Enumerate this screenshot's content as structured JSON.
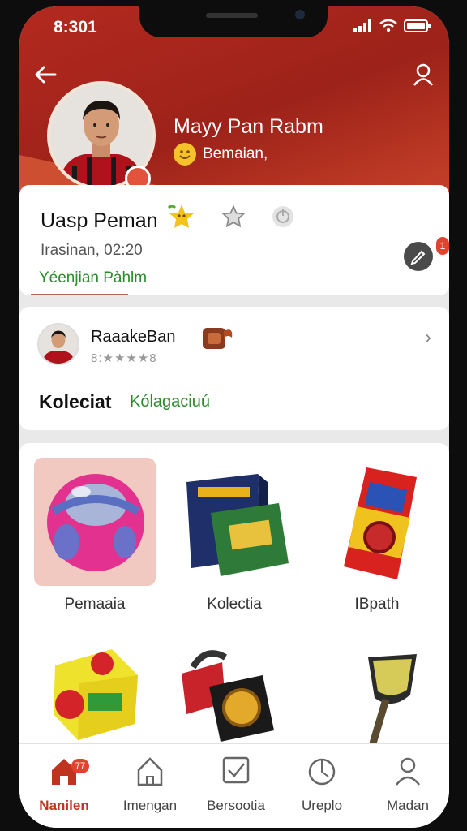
{
  "status_bar": {
    "time": "8:301"
  },
  "header": {
    "back_icon": "arrow-left-icon",
    "profile_icon": "user-icon",
    "name": "Mayy Pan Rabm",
    "subtitle": "Bemaian,"
  },
  "profile_card": {
    "title": "Uasp Peman",
    "meta": "Irasinan, 02:20",
    "link": "Yéenjian Pàhlm"
  },
  "player_card": {
    "name": "RaaakeBan",
    "rating": "8:★★★★8",
    "section_title": "Koleciat",
    "section_link": "Kólagaciuú"
  },
  "items": [
    {
      "label": "Pemaaia"
    },
    {
      "label": "Kolectia"
    },
    {
      "label": "IBpath"
    },
    {
      "label": ""
    },
    {
      "label": ""
    },
    {
      "label": ""
    }
  ],
  "tabs": [
    {
      "label": "Nanilen",
      "icon": "home-icon",
      "badge": "77"
    },
    {
      "label": "Imengan",
      "icon": "house-outline-icon"
    },
    {
      "label": "Bersootia",
      "icon": "checkbox-icon"
    },
    {
      "label": "Ureplo",
      "icon": "compass-icon"
    },
    {
      "label": "Madan",
      "icon": "person-icon"
    }
  ],
  "colors": {
    "brand": "#b3291f",
    "accent_green": "#2b8a2b",
    "badge": "#e2432f"
  }
}
